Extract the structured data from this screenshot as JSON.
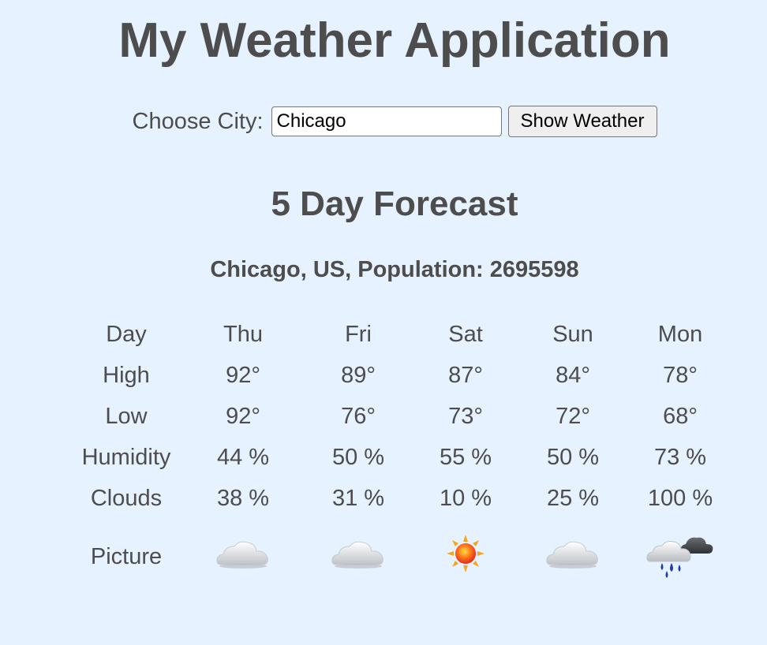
{
  "header": {
    "title": "My Weather Application"
  },
  "city_form": {
    "label": "Choose City:",
    "input_value": "Chicago",
    "button_label": "Show Weather"
  },
  "forecast": {
    "title": "5 Day Forecast",
    "location": "Chicago, US, Population: 2695598",
    "row_labels": {
      "day": "Day",
      "high": "High",
      "low": "Low",
      "humidity": "Humidity",
      "clouds": "Clouds",
      "picture": "Picture"
    },
    "days": [
      {
        "day": "Thu",
        "high": "92°",
        "low": "92°",
        "humidity": "44 %",
        "clouds": "38 %",
        "icon": "cloud-icon"
      },
      {
        "day": "Fri",
        "high": "89°",
        "low": "76°",
        "humidity": "50 %",
        "clouds": "31 %",
        "icon": "cloud-icon"
      },
      {
        "day": "Sat",
        "high": "87°",
        "low": "73°",
        "humidity": "55 %",
        "clouds": "10 %",
        "icon": "sun-icon"
      },
      {
        "day": "Sun",
        "high": "84°",
        "low": "72°",
        "humidity": "50 %",
        "clouds": "25 %",
        "icon": "cloud-icon"
      },
      {
        "day": "Mon",
        "high": "78°",
        "low": "68°",
        "humidity": "73 %",
        "clouds": "100 %",
        "icon": "rain-cloud-icon"
      }
    ]
  },
  "colors": {
    "background": "#e6f2ff",
    "text": "#4d4d4d"
  }
}
